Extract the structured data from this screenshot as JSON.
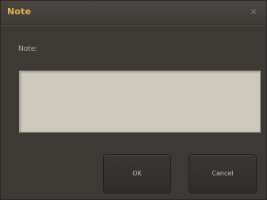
{
  "dialog": {
    "title": "Note",
    "close_glyph": "×",
    "close_icon": "close-icon",
    "field_label": "Note:",
    "note_value": "",
    "ok_label": "OK",
    "cancel_label": "Cancel"
  },
  "colors": {
    "title": "#e8b34a",
    "background": "#3d3935",
    "textarea": "#cfc8bd"
  }
}
